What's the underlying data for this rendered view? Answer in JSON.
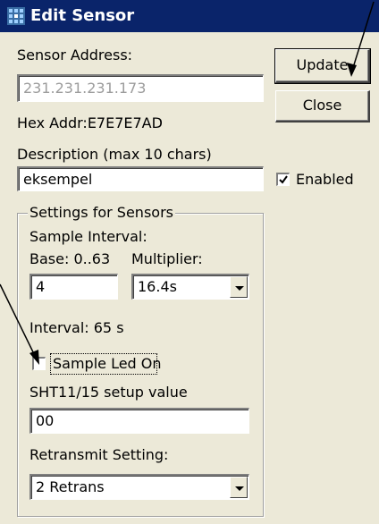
{
  "window": {
    "title": "Edit Sensor",
    "icon": "app-grid-icon"
  },
  "sensor_address": {
    "label": "Sensor Address:",
    "value": "231.231.231.173"
  },
  "hex_addr": {
    "text": "Hex Addr:E7E7E7AD"
  },
  "description": {
    "label": "Description (max 10 chars)",
    "value": "eksempel"
  },
  "enabled": {
    "label": "Enabled",
    "checked": true
  },
  "buttons": {
    "update": "Update",
    "close": "Close"
  },
  "settings": {
    "group_label": "Settings for Sensors",
    "sample_interval_label": "Sample Interval:",
    "base_label": "Base: 0..63",
    "multiplier_label": "Multiplier:",
    "base_value": "4",
    "multiplier_value": "16.4s",
    "interval_text": "Interval: 65 s",
    "sample_led_label": "Sample Led On",
    "sample_led_checked": false,
    "sht_label": "SHT11/15 setup value",
    "sht_value": "00",
    "retransmit_label": "Retransmit Setting:",
    "retransmit_value": "2 Retrans"
  },
  "annotation_color": "#000000"
}
